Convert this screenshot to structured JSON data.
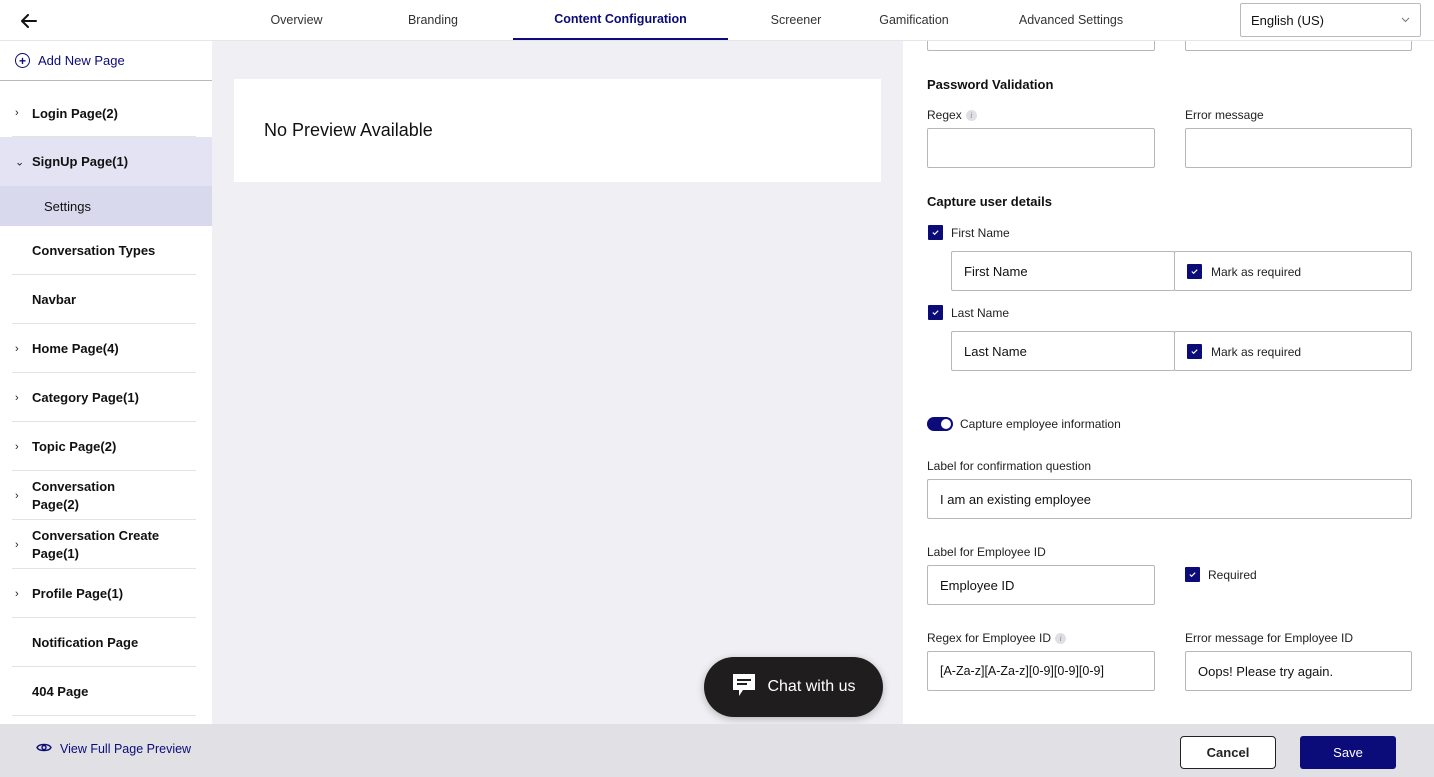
{
  "header": {
    "back_icon": "arrow-left-icon",
    "tabs": [
      {
        "label": "Overview",
        "active": false
      },
      {
        "label": "Branding",
        "active": false
      },
      {
        "label": "Content Configuration",
        "active": true
      },
      {
        "label": "Screener",
        "active": false
      },
      {
        "label": "Gamification",
        "active": false
      },
      {
        "label": "Advanced Settings",
        "active": false
      }
    ],
    "language": {
      "selected": "English (US)",
      "icon": "chevron-down-icon"
    }
  },
  "sidebar": {
    "add_page_label": "Add New Page",
    "add_page_icon": "plus-circle-icon",
    "items": [
      {
        "label": "Login Page(2)",
        "has_children": true,
        "expanded": false
      },
      {
        "label": "SignUp Page(1)",
        "has_children": true,
        "expanded": true,
        "children": [
          {
            "label": "Settings",
            "selected": true
          }
        ]
      },
      {
        "label": "Conversation Types",
        "has_children": false
      },
      {
        "label": "Navbar",
        "has_children": false
      },
      {
        "label": "Home Page(4)",
        "has_children": true,
        "expanded": false
      },
      {
        "label": "Category Page(1)",
        "has_children": true,
        "expanded": false
      },
      {
        "label": "Topic Page(2)",
        "has_children": true,
        "expanded": false
      },
      {
        "label": "Conversation Page(2)",
        "line1": "Conversation",
        "line2": "Page(2)",
        "has_children": true,
        "expanded": false
      },
      {
        "label": "Conversation Create Page(1)",
        "line1": "Conversation Create",
        "line2": "Page(1)",
        "has_children": true,
        "expanded": false
      },
      {
        "label": "Profile Page(1)",
        "has_children": true,
        "expanded": false
      },
      {
        "label": "Notification Page",
        "has_children": false
      },
      {
        "label": "404 Page",
        "has_children": false
      }
    ]
  },
  "preview": {
    "message": "No Preview Available",
    "chat_button_label": "Chat with us",
    "chat_icon": "chat-bubble-icon"
  },
  "form": {
    "password_validation": {
      "heading": "Password Validation",
      "regex_label": "Regex",
      "regex_value": "",
      "error_label": "Error message",
      "error_value": ""
    },
    "capture_user_details": {
      "heading": "Capture user details",
      "fields": [
        {
          "checkbox_label": "First Name",
          "checked": true,
          "input_value": "First Name",
          "required_label": "Mark as required",
          "required": true
        },
        {
          "checkbox_label": "Last Name",
          "checked": true,
          "input_value": "Last Name",
          "required_label": "Mark as required",
          "required": true
        }
      ]
    },
    "employee": {
      "toggle_label": "Capture employee information",
      "toggle_on": true,
      "confirmation_label": "Label for confirmation question",
      "confirmation_value": "I am an existing employee",
      "employee_id_label": "Label for Employee ID",
      "employee_id_value": "Employee ID",
      "required_label": "Required",
      "required": true,
      "regex_label": "Regex for Employee ID",
      "regex_value": "[A-Za-z][A-Za-z][0-9][0-9][0-9]",
      "error_label": "Error message for Employee ID",
      "error_value": "Oops! Please try again."
    }
  },
  "footer": {
    "view_preview_label": "View Full Page Preview",
    "view_preview_icon": "eye-icon",
    "cancel_label": "Cancel",
    "save_label": "Save"
  },
  "colors": {
    "accent": "#0b0b7a",
    "preview_bg": "#efeff4",
    "footer_bg": "#e1e0e5",
    "selected_bg": "#e3e3f3",
    "chat_button_bg": "#1f1d1d"
  }
}
